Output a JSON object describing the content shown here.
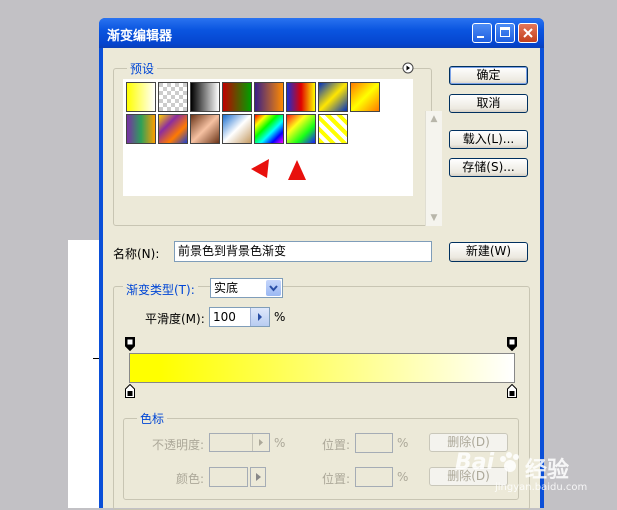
{
  "dialog": {
    "title": "渐变编辑器",
    "buttons": {
      "ok": "确定",
      "cancel": "取消",
      "load": "载入(L)...",
      "save": "存储(S)...",
      "new": "新建(W)"
    }
  },
  "presets": {
    "legend": "预设",
    "swatches": [
      {
        "id": "fg-to-bg",
        "css": "linear-gradient(90deg,#ffff00,#ffffff)"
      },
      {
        "id": "fg-to-transparent",
        "css": "repeating-conic-gradient(#ffffff 0 25%,#cccccc 0 50%) 0 0/8px 8px"
      },
      {
        "id": "black-white",
        "css": "linear-gradient(90deg,#000000,#ffffff)"
      },
      {
        "id": "red-green",
        "css": "linear-gradient(90deg,#c00000,#00a000)"
      },
      {
        "id": "violet-orange",
        "css": "linear-gradient(90deg,#3a1f86,#ff8a00)"
      },
      {
        "id": "blue-red-yellow",
        "css": "linear-gradient(90deg,#1c2fd0,#e00000,#ffff00)"
      },
      {
        "id": "blue-yellow-blue",
        "css": "linear-gradient(135deg,#0030c0,#ffe600,#0030c0)"
      },
      {
        "id": "orange-yellow-orange",
        "css": "linear-gradient(135deg,#ff7a00,#ffff00,#ff7a00)"
      },
      {
        "id": "violet-green-orange",
        "css": "linear-gradient(90deg,#7a2fa5,#2da05a,#ff9d00)"
      },
      {
        "id": "yellow-violet-orange-blue",
        "css": "linear-gradient(135deg,#ffd000,#8b2da0,#ff7a00,#1c40d0)"
      },
      {
        "id": "copper",
        "css": "linear-gradient(135deg,#6a3418,#f6c1a2,#6a3418)"
      },
      {
        "id": "chrome",
        "css": "linear-gradient(135deg,#1a6ed0,#ffffff,#c49a62)"
      },
      {
        "id": "spectrum",
        "css": "linear-gradient(135deg,#ff0000,#ffff00,#00ff00,#00ffff,#0000ff,#ff00ff)"
      },
      {
        "id": "transparent-rainbow",
        "css": "linear-gradient(135deg,rgba(255,0,0,.9),rgba(255,255,0,.9),rgba(0,255,0,.9),rgba(0,0,255,.9))"
      },
      {
        "id": "transparent-stripes",
        "css": "repeating-linear-gradient(45deg,#ffff00 0 4px,#ffffff 4px 8px)"
      }
    ]
  },
  "name": {
    "label": "名称(N):",
    "value": "前景色到背景色渐变"
  },
  "gradient_type": {
    "label": "渐变类型(T):",
    "value": "实底"
  },
  "smoothness": {
    "label": "平滑度(M):",
    "value": "100",
    "unit": "%"
  },
  "gradient_bar": {
    "start_color": "#ffff00",
    "end_color": "#ffffff"
  },
  "stops": {
    "legend": "色标",
    "opacity_label": "不透明度:",
    "opacity_unit": "%",
    "location1_label": "位置:",
    "location1_unit": "%",
    "delete1": "删除(D)",
    "color_label": "颜色:",
    "location2_label": "位置:",
    "location2_unit": "%",
    "delete2": "删除(D)"
  },
  "watermark": {
    "brand": "Bai",
    "text": "经验",
    "url": "jingyan.baidu.com"
  },
  "colors": {
    "titlebar": "#0a4fd8",
    "panel": "#ece9d8",
    "accent_label": "#0046d5",
    "annotation": "#e8100d"
  }
}
